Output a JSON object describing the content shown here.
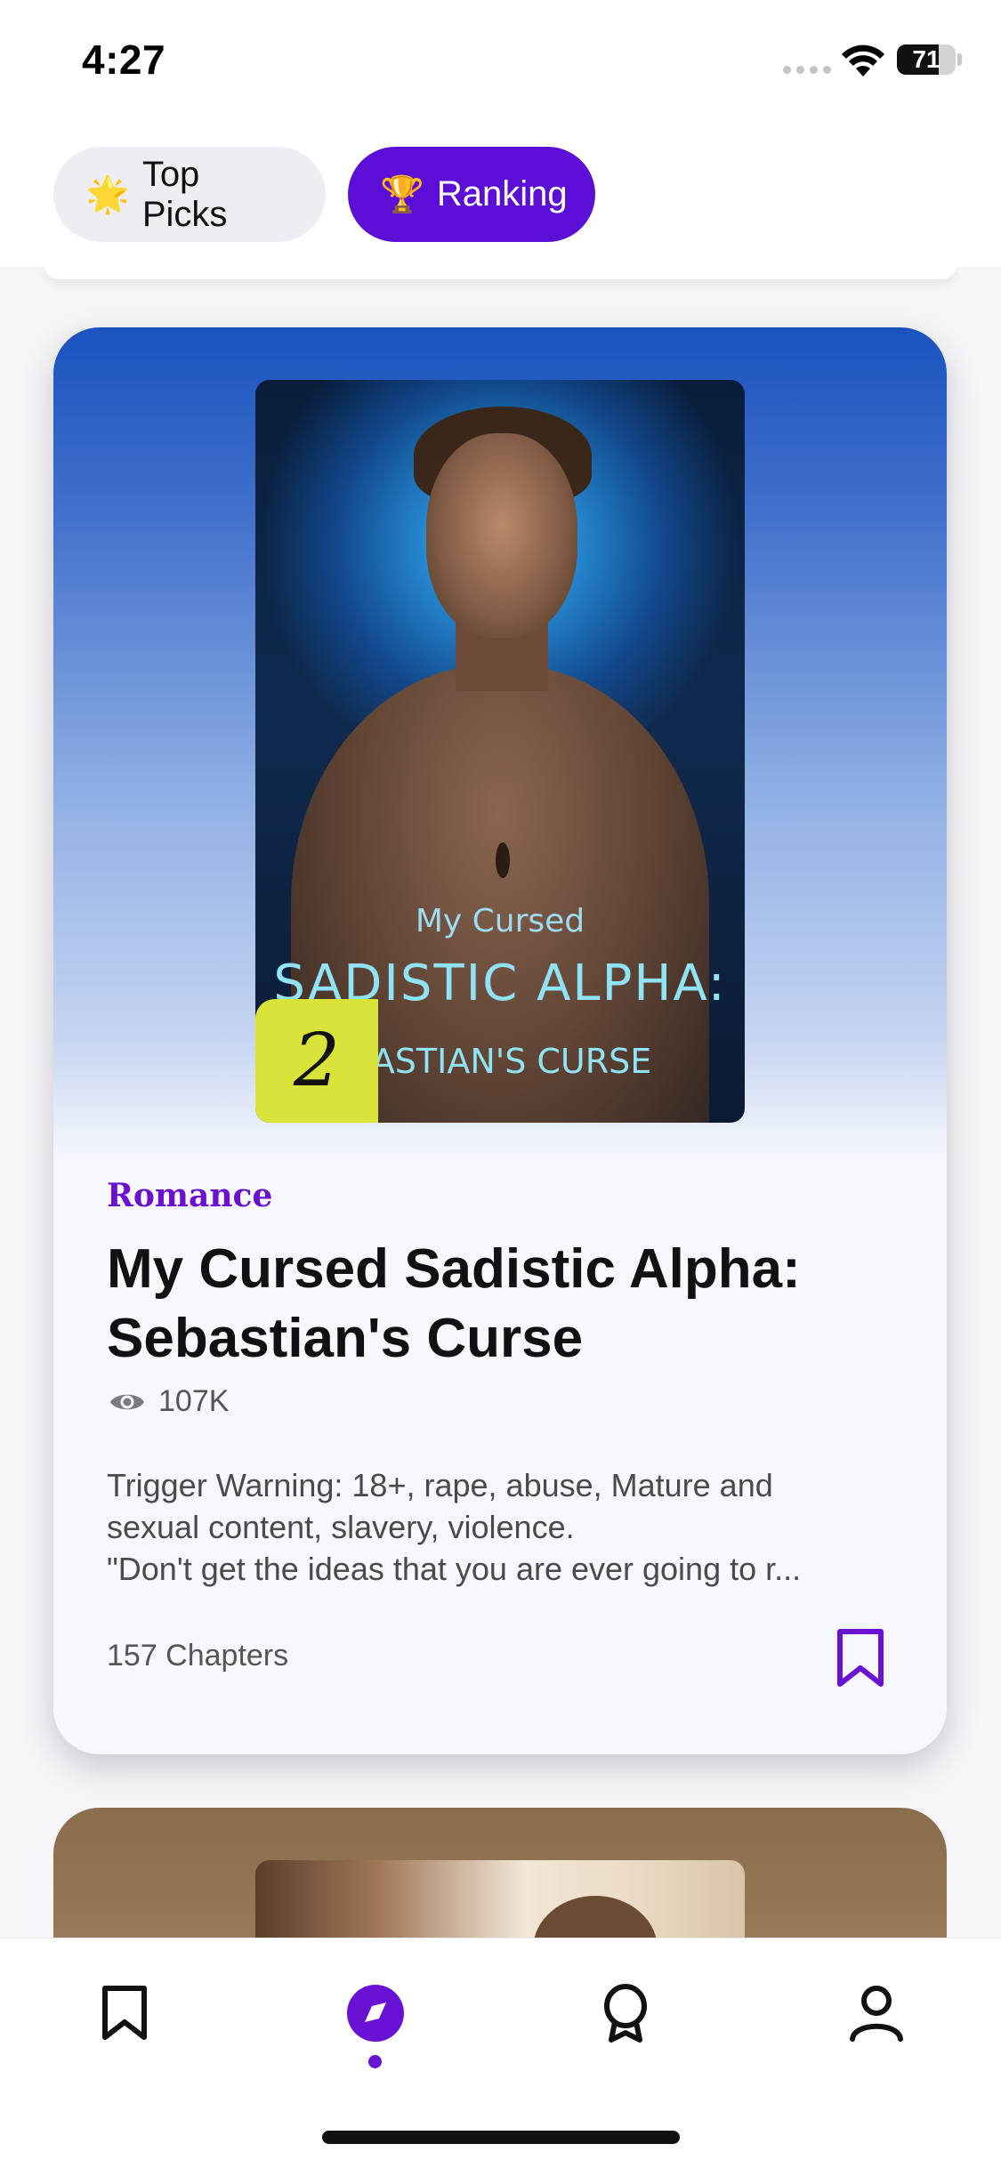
{
  "status_bar": {
    "time": "4:27",
    "battery_percent": "71",
    "battery_level": 0.71,
    "icons": [
      "cellular-signal-icon",
      "wifi-icon",
      "battery-icon"
    ]
  },
  "tabs": [
    {
      "label": "Top Picks",
      "icon": "star-icon",
      "glyph": "🌟",
      "active": false
    },
    {
      "label": "Ranking",
      "icon": "trophy-icon",
      "glyph": "🏆",
      "active": true
    }
  ],
  "book": {
    "rank": "2",
    "cover_lines": [
      "My Cursed",
      "SADISTIC ALPHA:",
      "BASTIAN'S CURSE"
    ],
    "genre": "Romance",
    "title": "My Cursed Sadistic Alpha: Sebastian's Curse",
    "views": "107K",
    "description_lines": [
      "Trigger Warning: 18+, rape, abuse, Mature and",
      "sexual content, slavery, violence.",
      "\"Don't get the ideas that you are ever going to r..."
    ],
    "chapters": "157 Chapters",
    "bookmark_icon": "bookmark-icon"
  },
  "bottom_nav": [
    {
      "name": "library",
      "icon": "bookmark-icon",
      "active": false
    },
    {
      "name": "discover",
      "icon": "compass-icon",
      "active": true
    },
    {
      "name": "rewards",
      "icon": "award-icon",
      "active": false
    },
    {
      "name": "profile",
      "icon": "user-icon",
      "active": false
    }
  ],
  "colors": {
    "accent": "#5b0fd6",
    "genre": "#6a10cf",
    "rank_badge": "#d9e33a",
    "card_gradient_top": "#1a53c0"
  }
}
